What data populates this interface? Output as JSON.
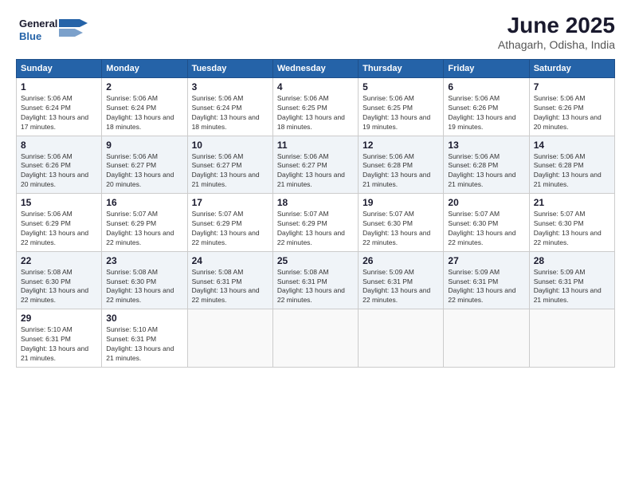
{
  "logo": {
    "line1": "General",
    "line2": "Blue"
  },
  "header": {
    "title": "June 2025",
    "subtitle": "Athagarh, Odisha, India"
  },
  "days_of_week": [
    "Sunday",
    "Monday",
    "Tuesday",
    "Wednesday",
    "Thursday",
    "Friday",
    "Saturday"
  ],
  "weeks": [
    [
      {
        "day": 1,
        "sunrise": "Sunrise: 5:06 AM",
        "sunset": "Sunset: 6:24 PM",
        "daylight": "Daylight: 13 hours and 17 minutes."
      },
      {
        "day": 2,
        "sunrise": "Sunrise: 5:06 AM",
        "sunset": "Sunset: 6:24 PM",
        "daylight": "Daylight: 13 hours and 18 minutes."
      },
      {
        "day": 3,
        "sunrise": "Sunrise: 5:06 AM",
        "sunset": "Sunset: 6:24 PM",
        "daylight": "Daylight: 13 hours and 18 minutes."
      },
      {
        "day": 4,
        "sunrise": "Sunrise: 5:06 AM",
        "sunset": "Sunset: 6:25 PM",
        "daylight": "Daylight: 13 hours and 18 minutes."
      },
      {
        "day": 5,
        "sunrise": "Sunrise: 5:06 AM",
        "sunset": "Sunset: 6:25 PM",
        "daylight": "Daylight: 13 hours and 19 minutes."
      },
      {
        "day": 6,
        "sunrise": "Sunrise: 5:06 AM",
        "sunset": "Sunset: 6:26 PM",
        "daylight": "Daylight: 13 hours and 19 minutes."
      },
      {
        "day": 7,
        "sunrise": "Sunrise: 5:06 AM",
        "sunset": "Sunset: 6:26 PM",
        "daylight": "Daylight: 13 hours and 20 minutes."
      }
    ],
    [
      {
        "day": 8,
        "sunrise": "Sunrise: 5:06 AM",
        "sunset": "Sunset: 6:26 PM",
        "daylight": "Daylight: 13 hours and 20 minutes."
      },
      {
        "day": 9,
        "sunrise": "Sunrise: 5:06 AM",
        "sunset": "Sunset: 6:27 PM",
        "daylight": "Daylight: 13 hours and 20 minutes."
      },
      {
        "day": 10,
        "sunrise": "Sunrise: 5:06 AM",
        "sunset": "Sunset: 6:27 PM",
        "daylight": "Daylight: 13 hours and 21 minutes."
      },
      {
        "day": 11,
        "sunrise": "Sunrise: 5:06 AM",
        "sunset": "Sunset: 6:27 PM",
        "daylight": "Daylight: 13 hours and 21 minutes."
      },
      {
        "day": 12,
        "sunrise": "Sunrise: 5:06 AM",
        "sunset": "Sunset: 6:28 PM",
        "daylight": "Daylight: 13 hours and 21 minutes."
      },
      {
        "day": 13,
        "sunrise": "Sunrise: 5:06 AM",
        "sunset": "Sunset: 6:28 PM",
        "daylight": "Daylight: 13 hours and 21 minutes."
      },
      {
        "day": 14,
        "sunrise": "Sunrise: 5:06 AM",
        "sunset": "Sunset: 6:28 PM",
        "daylight": "Daylight: 13 hours and 21 minutes."
      }
    ],
    [
      {
        "day": 15,
        "sunrise": "Sunrise: 5:06 AM",
        "sunset": "Sunset: 6:29 PM",
        "daylight": "Daylight: 13 hours and 22 minutes."
      },
      {
        "day": 16,
        "sunrise": "Sunrise: 5:07 AM",
        "sunset": "Sunset: 6:29 PM",
        "daylight": "Daylight: 13 hours and 22 minutes."
      },
      {
        "day": 17,
        "sunrise": "Sunrise: 5:07 AM",
        "sunset": "Sunset: 6:29 PM",
        "daylight": "Daylight: 13 hours and 22 minutes."
      },
      {
        "day": 18,
        "sunrise": "Sunrise: 5:07 AM",
        "sunset": "Sunset: 6:29 PM",
        "daylight": "Daylight: 13 hours and 22 minutes."
      },
      {
        "day": 19,
        "sunrise": "Sunrise: 5:07 AM",
        "sunset": "Sunset: 6:30 PM",
        "daylight": "Daylight: 13 hours and 22 minutes."
      },
      {
        "day": 20,
        "sunrise": "Sunrise: 5:07 AM",
        "sunset": "Sunset: 6:30 PM",
        "daylight": "Daylight: 13 hours and 22 minutes."
      },
      {
        "day": 21,
        "sunrise": "Sunrise: 5:07 AM",
        "sunset": "Sunset: 6:30 PM",
        "daylight": "Daylight: 13 hours and 22 minutes."
      }
    ],
    [
      {
        "day": 22,
        "sunrise": "Sunrise: 5:08 AM",
        "sunset": "Sunset: 6:30 PM",
        "daylight": "Daylight: 13 hours and 22 minutes."
      },
      {
        "day": 23,
        "sunrise": "Sunrise: 5:08 AM",
        "sunset": "Sunset: 6:30 PM",
        "daylight": "Daylight: 13 hours and 22 minutes."
      },
      {
        "day": 24,
        "sunrise": "Sunrise: 5:08 AM",
        "sunset": "Sunset: 6:31 PM",
        "daylight": "Daylight: 13 hours and 22 minutes."
      },
      {
        "day": 25,
        "sunrise": "Sunrise: 5:08 AM",
        "sunset": "Sunset: 6:31 PM",
        "daylight": "Daylight: 13 hours and 22 minutes."
      },
      {
        "day": 26,
        "sunrise": "Sunrise: 5:09 AM",
        "sunset": "Sunset: 6:31 PM",
        "daylight": "Daylight: 13 hours and 22 minutes."
      },
      {
        "day": 27,
        "sunrise": "Sunrise: 5:09 AM",
        "sunset": "Sunset: 6:31 PM",
        "daylight": "Daylight: 13 hours and 22 minutes."
      },
      {
        "day": 28,
        "sunrise": "Sunrise: 5:09 AM",
        "sunset": "Sunset: 6:31 PM",
        "daylight": "Daylight: 13 hours and 21 minutes."
      }
    ],
    [
      {
        "day": 29,
        "sunrise": "Sunrise: 5:10 AM",
        "sunset": "Sunset: 6:31 PM",
        "daylight": "Daylight: 13 hours and 21 minutes."
      },
      {
        "day": 30,
        "sunrise": "Sunrise: 5:10 AM",
        "sunset": "Sunset: 6:31 PM",
        "daylight": "Daylight: 13 hours and 21 minutes."
      },
      null,
      null,
      null,
      null,
      null
    ]
  ]
}
